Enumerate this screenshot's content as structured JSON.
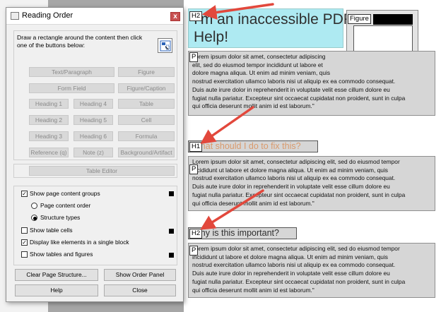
{
  "dialog": {
    "title": "Reading Order",
    "close_glyph": "x",
    "instructions": "Draw a rectangle around the content then click one of the buttons below:",
    "tag_buttons": {
      "text_paragraph": "Text/Paragraph",
      "figure": "Figure",
      "form_field": "Form Field",
      "figure_caption": "Figure/Caption",
      "heading1": "Heading 1",
      "heading4": "Heading 4",
      "table": "Table",
      "heading2": "Heading 2",
      "heading5": "Heading 5",
      "cell": "Cell",
      "heading3": "Heading 3",
      "heading6": "Heading 6",
      "formula": "Formula",
      "reference": "Reference (q)",
      "note": "Note (z)",
      "background_artifact": "Background/Artifact"
    },
    "table_editor": "Table Editor",
    "options": {
      "show_page_content_groups": "Show page content groups",
      "page_content_order": "Page content order",
      "structure_types": "Structure types",
      "show_table_cells": "Show table cells",
      "display_like_elements": "Display like elements in a single block",
      "show_tables_and_figures": "Show tables and figures",
      "checkmark": "✓"
    },
    "buttons": {
      "clear_page_structure": "Clear Page Structure...",
      "show_order_panel": "Show Order Panel",
      "help": "Help",
      "close": "Close"
    }
  },
  "document": {
    "title_tag": "H2",
    "title_line1": "I'm an inaccessible PDF.",
    "title_line2": "Help!",
    "figure_tag": "Figure",
    "paragraph_tag": "P",
    "heading1_tag": "H1",
    "heading1_text": "What should I do to fix this?",
    "heading2_tag": "H2",
    "heading2_text": "Why is this important?",
    "paragraph_lines": [
      "Lorem ipsum dolor sit amet, consectetur adipiscing elit, sed do eiusmod tempor",
      "incididunt ut labore et dolore magna aliqua. Ut enim ad minim veniam, quis",
      "nostrud exercitation ullamco laboris nisi ut aliquip ex ea commodo consequat.",
      "Duis aute irure dolor in reprehenderit in voluptate velit esse cillum dolore eu",
      "fugiat nulla pariatur. Excepteur sint occaecat cupidatat non proident, sunt in culpa",
      "qui officia deserunt mollit anim id est laborum.\""
    ],
    "paragraph1_lines": [
      "Lorem ipsum dolor sit amet, consectetur adipiscing",
      "elit, sed do eiusmod tempor incididunt ut labore et",
      "dolore magna aliqua. Ut enim ad minim veniam, quis",
      "nostrud exercitation ullamco laboris nisi ut aliquip ex ea commodo consequat.",
      "Duis aute irure dolor in reprehenderit in voluptate velit esse cillum dolore eu",
      "fugiat nulla pariatur. Excepteur sint occaecat cupidatat non proident, sunt in culpa",
      "qui officia deserunt mollit anim id est laborum.\""
    ]
  },
  "colors": {
    "title_highlight": "#aeeaf2",
    "heading_text": "#d99a6c",
    "arrow": "#e2483c",
    "paragraph_bg": "#d6d6d6"
  }
}
